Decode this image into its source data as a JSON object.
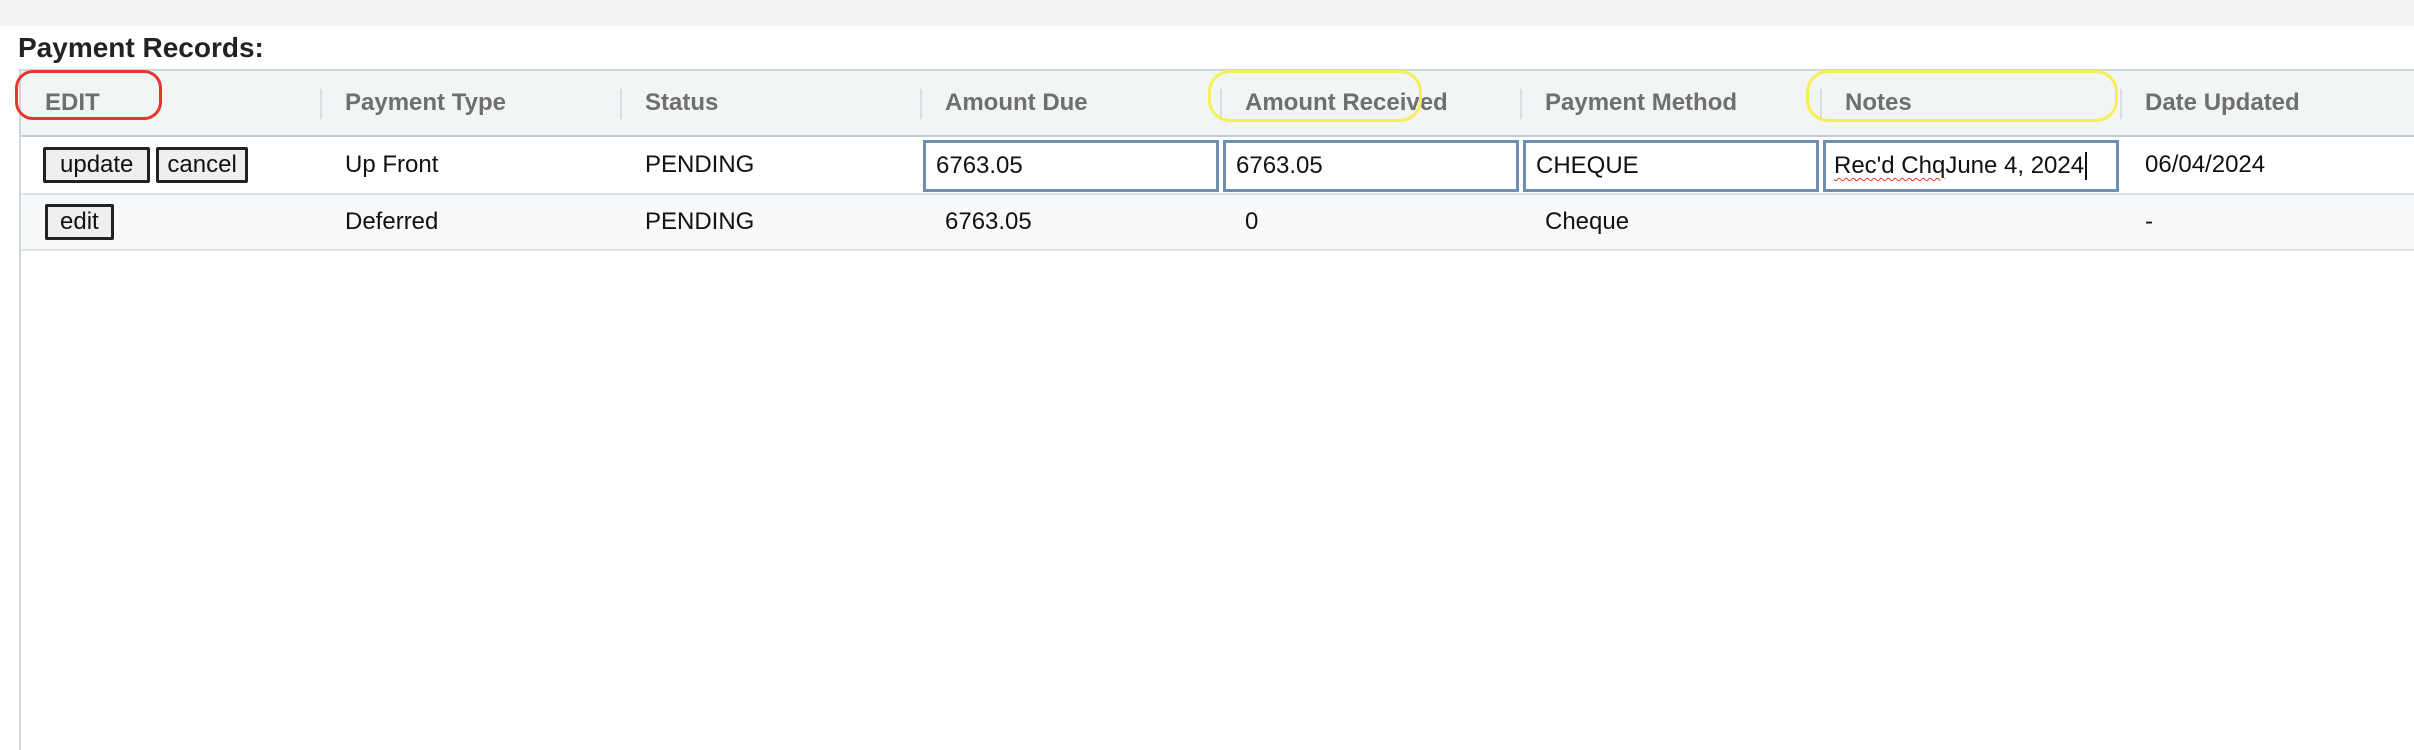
{
  "section": {
    "title": "Payment Records:"
  },
  "table": {
    "columns": [
      "EDIT",
      "Payment Type",
      "Status",
      "Amount Due",
      "Amount Received",
      "Payment Method",
      "Notes",
      "Date Updated"
    ],
    "rows": [
      {
        "update_label": "update",
        "cancel_label": "cancel",
        "payment_type": "Up Front",
        "status": "PENDING",
        "amount_due": "6763.05",
        "amount_received": "6763.05",
        "payment_method": "CHEQUE",
        "notes_part1": "Rec'd Chq",
        "notes_part2": " June 4, 2024",
        "date_updated": "06/04/2024"
      },
      {
        "edit_label": "edit",
        "payment_type": "Deferred",
        "status": "PENDING",
        "amount_due": "6763.05",
        "amount_received": "0",
        "payment_method": "Cheque",
        "notes": "",
        "date_updated": "-"
      }
    ]
  },
  "annotations": {
    "red_highlight_color": "#e5362b",
    "yellow_highlight_color": "#f4f051"
  }
}
